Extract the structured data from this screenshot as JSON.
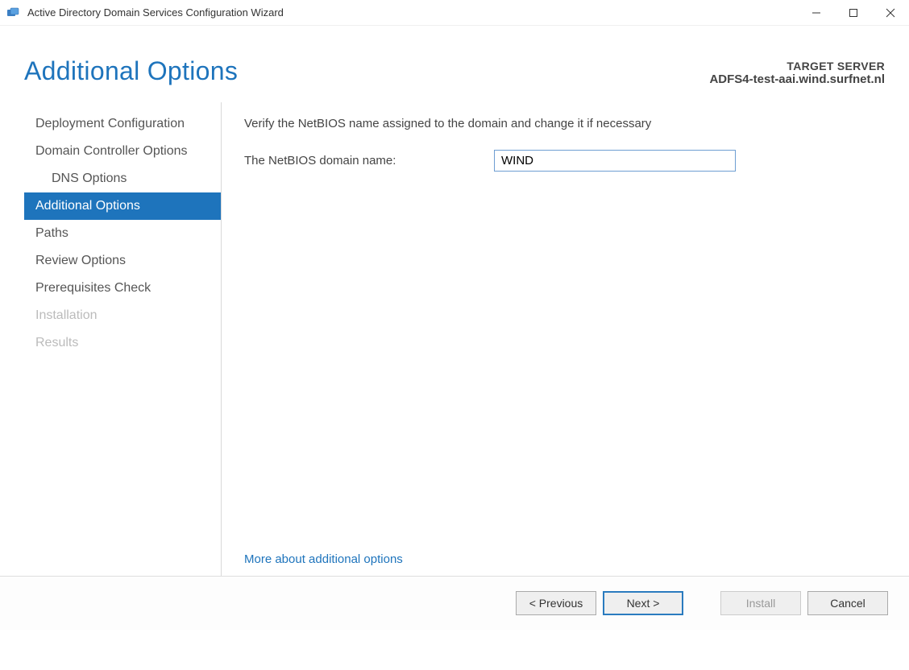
{
  "window": {
    "title": "Active Directory Domain Services Configuration Wizard"
  },
  "header": {
    "page_title": "Additional Options",
    "target_label": "TARGET SERVER",
    "target_value": "ADFS4-test-aai.wind.surfnet.nl"
  },
  "sidebar": {
    "items": [
      {
        "label": "Deployment Configuration",
        "indent": false,
        "active": false,
        "disabled": false
      },
      {
        "label": "Domain Controller Options",
        "indent": false,
        "active": false,
        "disabled": false
      },
      {
        "label": "DNS Options",
        "indent": true,
        "active": false,
        "disabled": false
      },
      {
        "label": "Additional Options",
        "indent": false,
        "active": true,
        "disabled": false
      },
      {
        "label": "Paths",
        "indent": false,
        "active": false,
        "disabled": false
      },
      {
        "label": "Review Options",
        "indent": false,
        "active": false,
        "disabled": false
      },
      {
        "label": "Prerequisites Check",
        "indent": false,
        "active": false,
        "disabled": false
      },
      {
        "label": "Installation",
        "indent": false,
        "active": false,
        "disabled": true
      },
      {
        "label": "Results",
        "indent": false,
        "active": false,
        "disabled": true
      }
    ]
  },
  "main": {
    "instruction": "Verify the NetBIOS name assigned to the domain and change it if necessary",
    "field_label": "The NetBIOS domain name:",
    "field_value": "WIND",
    "more_link": "More about additional options"
  },
  "footer": {
    "previous": "< Previous",
    "next": "Next >",
    "install": "Install",
    "cancel": "Cancel"
  }
}
